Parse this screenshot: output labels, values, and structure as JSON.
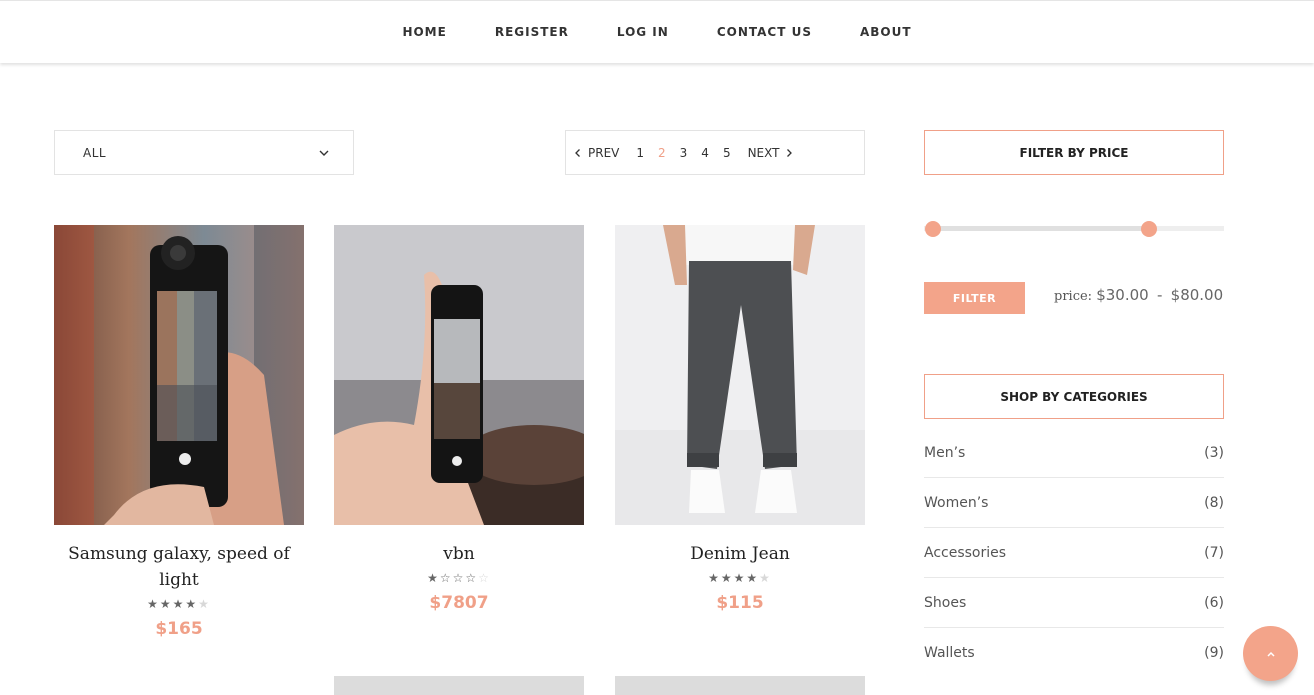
{
  "nav": {
    "items": [
      "HOME",
      "REGISTER",
      "LOG IN",
      "CONTACT US",
      "ABOUT"
    ]
  },
  "sort_select": {
    "value": "ALL"
  },
  "pagination": {
    "prev": "PREV",
    "next": "NEXT",
    "pages": [
      "1",
      "2",
      "3",
      "4",
      "5"
    ],
    "current": "2"
  },
  "products": [
    {
      "title": "Samsung galaxy, speed of light",
      "rating": 4,
      "price": "$165"
    },
    {
      "title": "vbn",
      "rating": 1,
      "price": "$7807"
    },
    {
      "title": "Denim Jean",
      "rating": 4,
      "price": "$115"
    }
  ],
  "filter": {
    "heading": "FILTER BY PRICE",
    "button": "FILTER",
    "price_prefix": "price:",
    "min_value": "$30.00",
    "separator": "-",
    "max_value": "$80.00",
    "slider_min_fraction": 0.03,
    "slider_max_fraction": 0.75
  },
  "categories": {
    "heading": "SHOP BY CATEGORIES",
    "items": [
      {
        "name": "Men’s",
        "count": "(3)"
      },
      {
        "name": "Women’s",
        "count": "(8)"
      },
      {
        "name": "Accessories",
        "count": "(7)"
      },
      {
        "name": "Shoes",
        "count": "(6)"
      },
      {
        "name": "Wallets",
        "count": "(9)"
      }
    ]
  },
  "colors": {
    "accent": "#f3a48a",
    "text": "#333333"
  }
}
